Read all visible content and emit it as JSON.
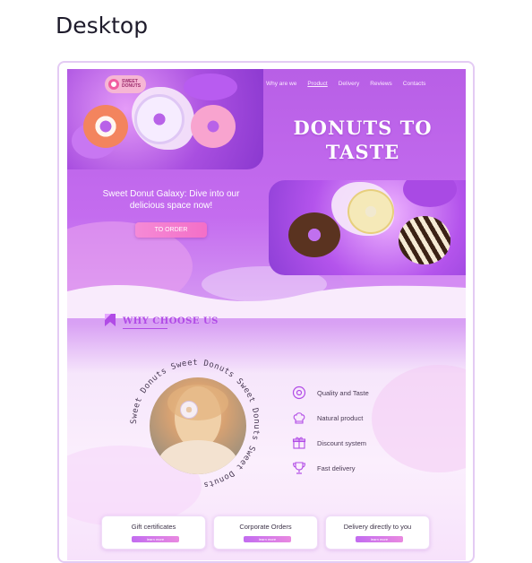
{
  "page_heading": "Desktop",
  "nav": {
    "items": [
      "Why are we",
      "Product",
      "Delivery",
      "Reviews",
      "Contacts"
    ],
    "active_index": 1
  },
  "logo": {
    "text_line1": "SWEET",
    "text_line2": "DONUTS"
  },
  "hero": {
    "title_line1": "DONUTS TO",
    "title_line2": "TASTE",
    "tagline": "Sweet Donut Galaxy: Dive into our delicious space now!",
    "order_button": "TO ORDER"
  },
  "why": {
    "title": "WHY CHOOSE US",
    "circle_text": "Sweet Donuts Sweet Donuts Sweet Donuts Sweet Donuts",
    "features": [
      {
        "icon": "donut-icon",
        "label": "Quality and Taste"
      },
      {
        "icon": "chef-hat-icon",
        "label": "Natural product"
      },
      {
        "icon": "gift-icon",
        "label": "Discount system"
      },
      {
        "icon": "trophy-icon",
        "label": "Fast delivery"
      }
    ]
  },
  "cards": [
    {
      "title": "Gift certificates",
      "button": "learn more"
    },
    {
      "title": "Corporate Orders",
      "button": "learn more"
    },
    {
      "title": "Delivery directly to you",
      "button": "learn more"
    }
  ],
  "colors": {
    "accent": "#b14be6",
    "hero_bg": "#b85fe6",
    "button": "#f46fc7"
  }
}
